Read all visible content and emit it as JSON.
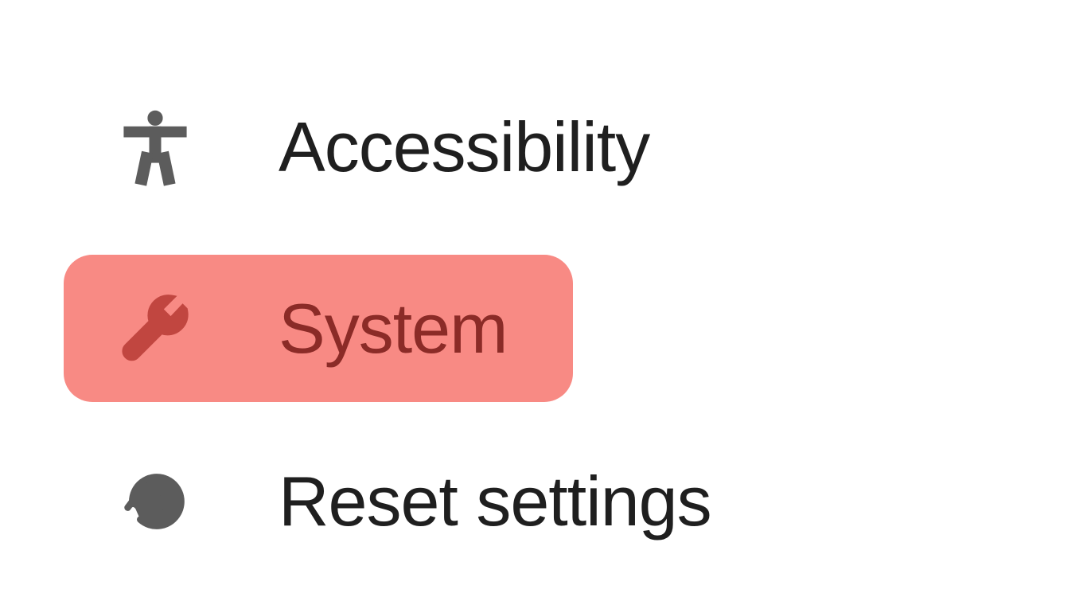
{
  "menu": {
    "items": [
      {
        "label": "Accessibility"
      },
      {
        "label": "System"
      },
      {
        "label": "Reset settings"
      }
    ]
  },
  "colors": {
    "highlight_bg": "#f88a84",
    "highlight_fg": "#8b2b27",
    "icon_normal": "#5c5c5c"
  }
}
